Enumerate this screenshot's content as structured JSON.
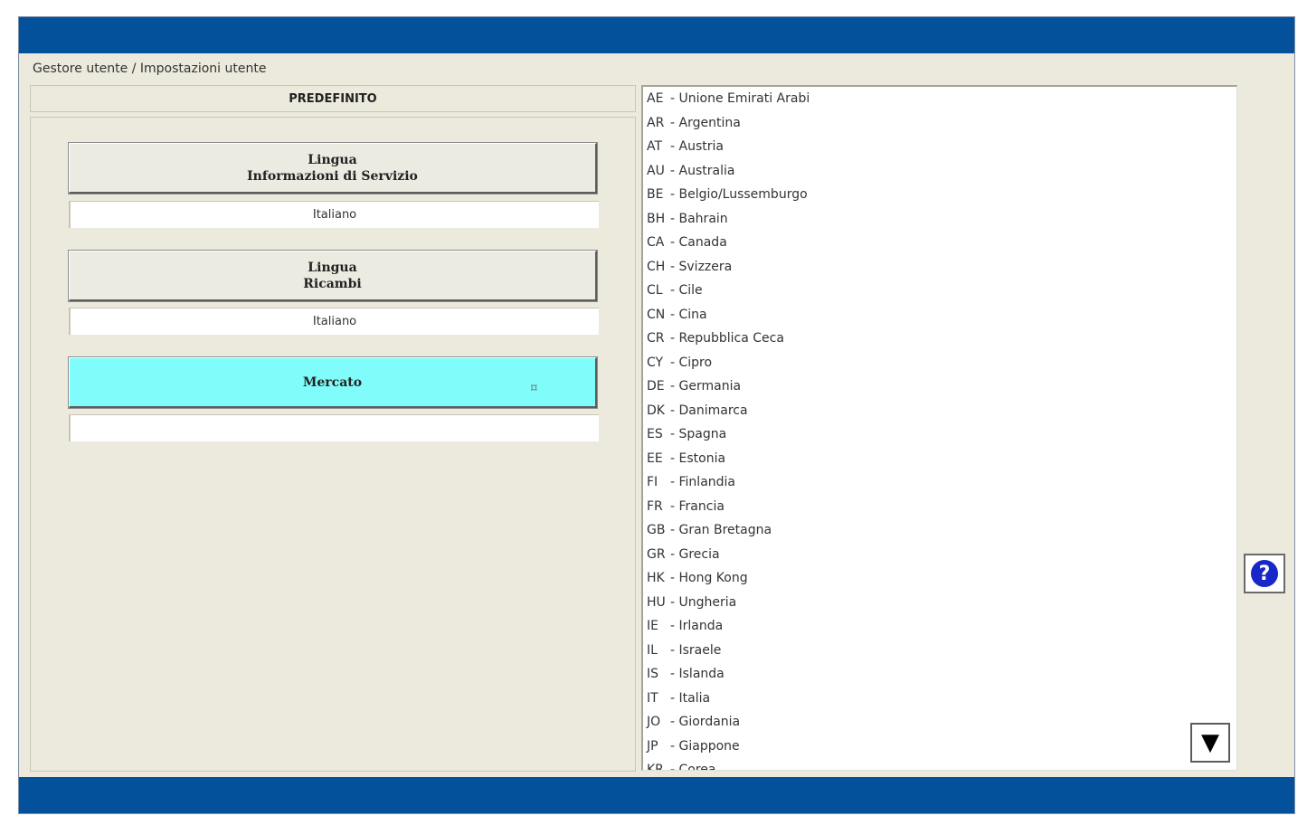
{
  "breadcrumb": "Gestore utente / Impostazioni utente",
  "panel_title": "PREDEFINITO",
  "settings": [
    {
      "line1": "Lingua",
      "line2": "Informazioni di Servizio",
      "value": "Italiano"
    },
    {
      "line1": "Lingua",
      "line2": "Ricambi",
      "value": "Italiano"
    },
    {
      "line1": "Mercato",
      "line2": "",
      "value": ""
    }
  ],
  "cursor_glyph": "⌑",
  "countries": [
    {
      "code": "AE",
      "name": "- Unione Emirati Arabi"
    },
    {
      "code": "AR",
      "name": "- Argentina"
    },
    {
      "code": "AT",
      "name": "- Austria"
    },
    {
      "code": "AU",
      "name": "- Australia"
    },
    {
      "code": "BE",
      "name": "- Belgio/Lussemburgo"
    },
    {
      "code": "BH",
      "name": "- Bahrain"
    },
    {
      "code": "CA",
      "name": "- Canada"
    },
    {
      "code": "CH",
      "name": "- Svizzera"
    },
    {
      "code": "CL",
      "name": "- Cile"
    },
    {
      "code": "CN",
      "name": "- Cina"
    },
    {
      "code": "CR",
      "name": "- Repubblica Ceca"
    },
    {
      "code": "CY",
      "name": "- Cipro"
    },
    {
      "code": "DE",
      "name": "- Germania"
    },
    {
      "code": "DK",
      "name": "- Danimarca"
    },
    {
      "code": "ES",
      "name": "- Spagna"
    },
    {
      "code": "EE",
      "name": "- Estonia"
    },
    {
      "code": "FI",
      "name": "- Finlandia"
    },
    {
      "code": "FR",
      "name": "- Francia"
    },
    {
      "code": "GB",
      "name": "- Gran Bretagna"
    },
    {
      "code": "GR",
      "name": "- Grecia"
    },
    {
      "code": "HK",
      "name": "- Hong Kong"
    },
    {
      "code": "HU",
      "name": "- Ungheria"
    },
    {
      "code": "IE",
      "name": "- Irlanda"
    },
    {
      "code": "IL",
      "name": "- Israele"
    },
    {
      "code": "IS",
      "name": "- Islanda"
    },
    {
      "code": "IT",
      "name": "- Italia"
    },
    {
      "code": "JO",
      "name": "- Giordania"
    },
    {
      "code": "JP",
      "name": "- Giappone"
    },
    {
      "code": "KR",
      "name": "- Corea"
    }
  ],
  "scroll_down_glyph": "▼",
  "help_glyph": "?",
  "colors": {
    "title_bar": "#03519a",
    "background": "#eceadd",
    "active_button": "#80fcfb",
    "help_icon": "#1727c8"
  }
}
